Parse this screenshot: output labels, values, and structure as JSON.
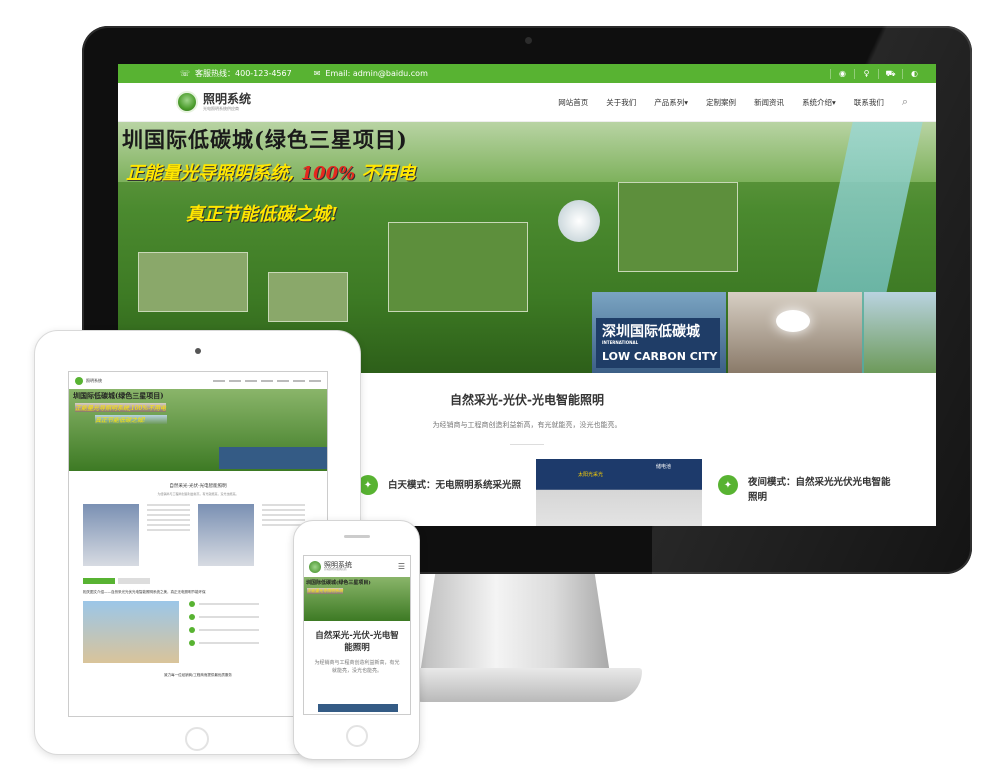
{
  "desktop": {
    "topbar": {
      "hotline": "客服热线：400-123-4567",
      "email": "Email: admin@baidu.com",
      "socials": [
        "weibo-icon",
        "qq-icon",
        "cart-icon",
        "wechat-icon"
      ]
    },
    "header": {
      "logo_name": "照明系统",
      "logo_tagline": "光电照明系统供应商",
      "nav": [
        "网站首页",
        "关于我们",
        "产品系列▾",
        "定制案例",
        "新闻资讯",
        "系统介绍▾",
        "联系我们"
      ]
    },
    "banner": {
      "line1": "圳国际低碳城(绿色三星项目)",
      "line2_a": "正能量光导照明系统,",
      "line2_b": "100%",
      "line2_c": "不用电",
      "line3": "真正节能低碳之城!",
      "sign_cn": "深圳国际低碳城",
      "sign_small": "INTERNATIONAL",
      "sign_en": "LOW CARBON CITY"
    },
    "section": {
      "title": "自然采光-光伏-光电智能照明",
      "subtitle": "为经销商与工程商创造利益新高，有光就能亮，没光也能亮。",
      "day_mode": "白天模式：无电照明系统采光照",
      "night_mode": "夜间模式：自然采光光伏光电智能照明",
      "img_label1": "太阳光采光",
      "img_label2": "储电池"
    }
  },
  "tablet": {
    "banner_line1": "圳国际低碳城(绿色三星项目)",
    "banner_line2": "正能量光导照明系统,100%不用电",
    "banner_line3": "真正节能低碳之城!",
    "section_title": "自然采光-光伏-光电智能照明",
    "section_sub": "为经销商与工程商创造利益新高，有光就能亮，没光也能亮。",
    "heading2": "相关图文介绍——自然采光光伏光电智能照明系统之美，真正无电照明节能环保",
    "footer_line": "致力每一位经销商/工程商而提供最优质服务"
  },
  "phone": {
    "logo_name": "照明系统",
    "logo_tagline": "光电照明系统供应商",
    "banner_line1": "圳国际低碳城(绿色三星项目)",
    "banner_line2": "正能量光导照明系统",
    "title": "自然采光-光伏-光电智能照明",
    "subtitle": "为经销商与工程商创造利益新高，有光就能亮，没光也能亮。"
  }
}
